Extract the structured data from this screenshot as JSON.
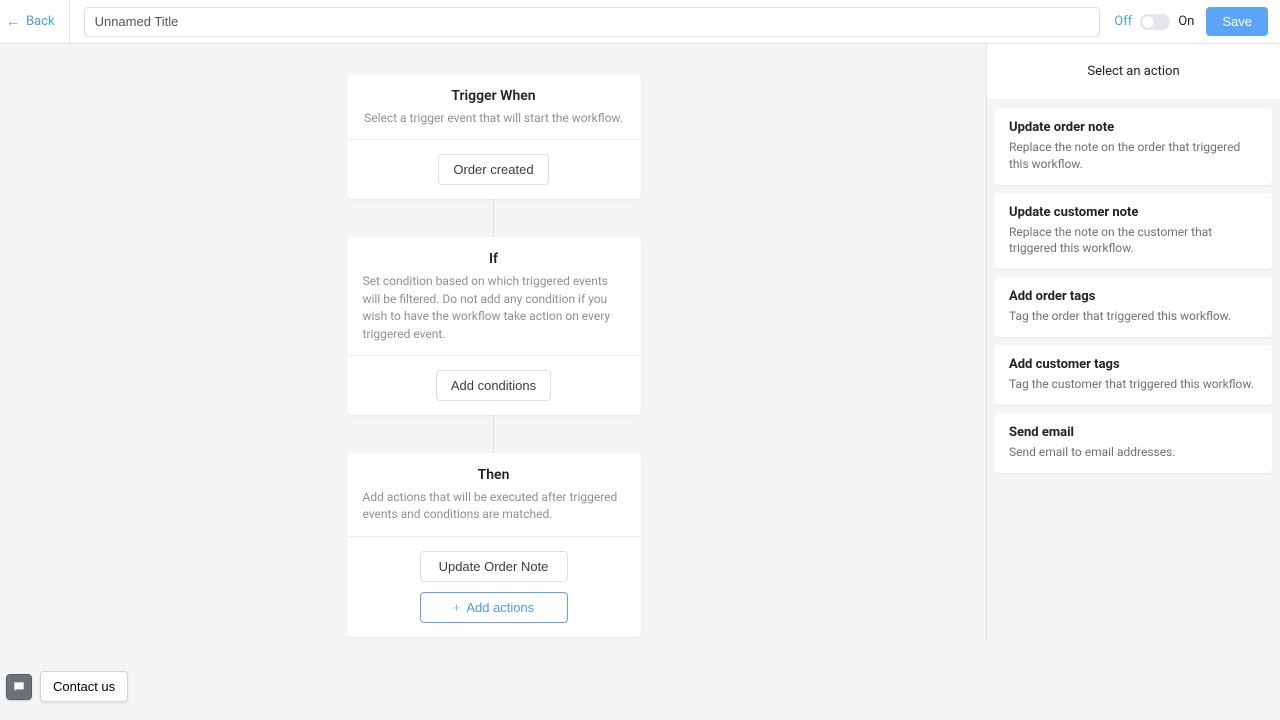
{
  "header": {
    "back": "Back",
    "title_value": "Unnamed Title",
    "off": "Off",
    "on": "On",
    "save": "Save"
  },
  "flow": {
    "trigger": {
      "title": "Trigger When",
      "desc": "Select a trigger event that will start the workflow.",
      "button": "Order created"
    },
    "condition": {
      "title": "If",
      "desc": "Set condition based on which triggered events will be filtered. Do not add any condition if you wish to have the workflow take action on every triggered event.",
      "button": "Add conditions"
    },
    "then": {
      "title": "Then",
      "desc": "Add actions that will be executed after triggered events and conditions are matched.",
      "action1": "Update Order Note",
      "add_btn": "Add actions"
    }
  },
  "sidebar": {
    "heading": "Select an action",
    "actions": [
      {
        "title": "Update order note",
        "desc": "Replace the note on the order that triggered this workflow."
      },
      {
        "title": "Update customer note",
        "desc": "Replace the note on the customer that triggered this workflow."
      },
      {
        "title": "Add order tags",
        "desc": "Tag the order that triggered this workflow."
      },
      {
        "title": "Add customer tags",
        "desc": "Tag the customer that triggered this workflow."
      },
      {
        "title": "Send email",
        "desc": "Send email to email addresses."
      }
    ]
  },
  "dock": {
    "contact": "Contact us"
  }
}
